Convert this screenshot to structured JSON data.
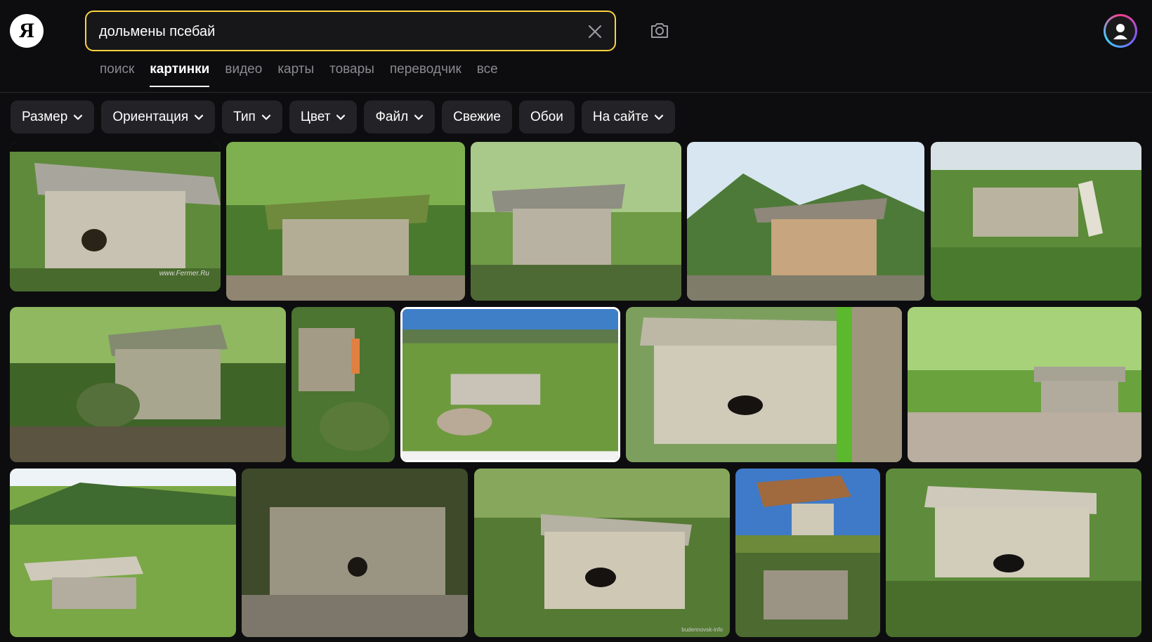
{
  "logo": {
    "letter": "Я"
  },
  "search": {
    "query": "дольмены псебай"
  },
  "tabs": [
    {
      "label": "поиск",
      "active": false
    },
    {
      "label": "картинки",
      "active": true
    },
    {
      "label": "видео",
      "active": false
    },
    {
      "label": "карты",
      "active": false
    },
    {
      "label": "товары",
      "active": false
    },
    {
      "label": "переводчик",
      "active": false
    },
    {
      "label": "все",
      "active": false
    }
  ],
  "filters": [
    {
      "label": "Размер",
      "dropdown": true
    },
    {
      "label": "Ориентация",
      "dropdown": true
    },
    {
      "label": "Тип",
      "dropdown": true
    },
    {
      "label": "Цвет",
      "dropdown": true
    },
    {
      "label": "Файл",
      "dropdown": true
    },
    {
      "label": "Свежие",
      "dropdown": false
    },
    {
      "label": "Обои",
      "dropdown": false
    },
    {
      "label": "На сайте",
      "dropdown": true
    }
  ],
  "results": {
    "image_count": 15,
    "watermarks": [
      "www.Fermer.Ru",
      "budennovsk-info"
    ]
  },
  "colors": {
    "accent": "#fcd33f",
    "background": "#0d0d0f",
    "chip": "#232327"
  }
}
